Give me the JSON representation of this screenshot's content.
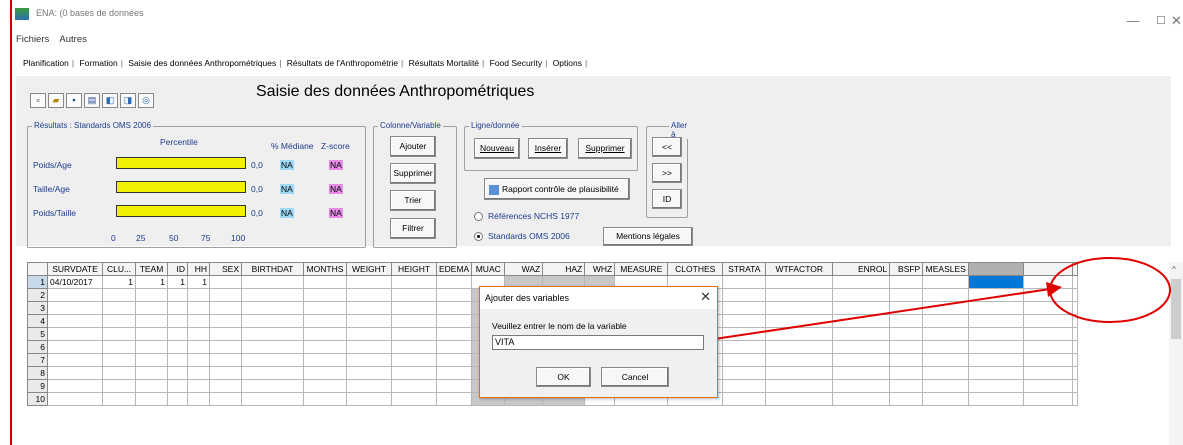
{
  "window": {
    "title": "ENA: (0 bases de données",
    "min": "—",
    "max": "☐",
    "close": "✕"
  },
  "menu": [
    "Fichiers",
    "Autres"
  ],
  "tabs": [
    "Planification",
    "Formation",
    "Saisie des données Anthropométriques",
    "Résultats de l'Anthropométrie",
    "Résultats Mortalité",
    "Food Security",
    "Options"
  ],
  "page_title": "Saisie des données Anthropométriques",
  "results": {
    "title": "Résultats : Standards OMS 2006",
    "percentile_label": "Percentile",
    "median_label": "% Médiane",
    "zscore_label": "Z-score",
    "rows": [
      {
        "label": "Poids/Age",
        "value": "0,0",
        "median": "NA",
        "zscore": "NA"
      },
      {
        "label": "Taille/Age",
        "value": "0,0",
        "median": "NA",
        "zscore": "NA"
      },
      {
        "label": "Poids/Taille",
        "value": "0,0",
        "median": "NA",
        "zscore": "NA"
      }
    ],
    "scale": [
      "0",
      "25",
      "50",
      "75",
      "100"
    ]
  },
  "colvar": {
    "title": "Colonne/Variable",
    "ajouter": "Ajouter",
    "supprimer": "Supprimer",
    "trier": "Trier",
    "filtrer": "Filtrer"
  },
  "ligne": {
    "title": "Ligne/donnée",
    "nouveau": "Nouveau",
    "inserer": "Insérer",
    "supprimer": "Supprimer",
    "rapport": "Rapport contrôle de plausibilité",
    "ref_nchs": "Références NCHS 1977",
    "std_oms": "Standards OMS 2006",
    "mentions": "Mentions légales"
  },
  "aller": {
    "title": "Aller à",
    "prev": "<<",
    "next": ">>",
    "id": "ID"
  },
  "grid": {
    "columns": [
      "SURVDATE",
      "CLU...",
      "TEAM",
      "ID",
      "HH",
      "SEX",
      "BIRTHDAT",
      "MONTHS",
      "WEIGHT",
      "HEIGHT",
      "EDEMA",
      "MUAC",
      "WAZ",
      "HAZ",
      "WHZ",
      "MEASURE",
      "CLOTHES",
      "STRATA",
      "WTFACTOR",
      "ENROL",
      "BSFP",
      "MEASLES",
      ""
    ],
    "row_numbers": [
      "1",
      "2",
      "3",
      "4",
      "5",
      "6",
      "7",
      "8",
      "9",
      "10"
    ],
    "row1": [
      "04/10/2017",
      "1",
      "1",
      "1",
      "1"
    ]
  },
  "dialog": {
    "title": "Ajouter des variables",
    "prompt": "Veuillez entrer le nom de la variable",
    "value": "VITA",
    "ok": "OK",
    "cancel": "Cancel"
  },
  "colors": {
    "accent_red": "#e00000",
    "selected_cell": "#0078d7",
    "bar_yellow": "#f0f000",
    "na_blue": "#9fd9f5",
    "na_magenta": "#e28ae6"
  }
}
